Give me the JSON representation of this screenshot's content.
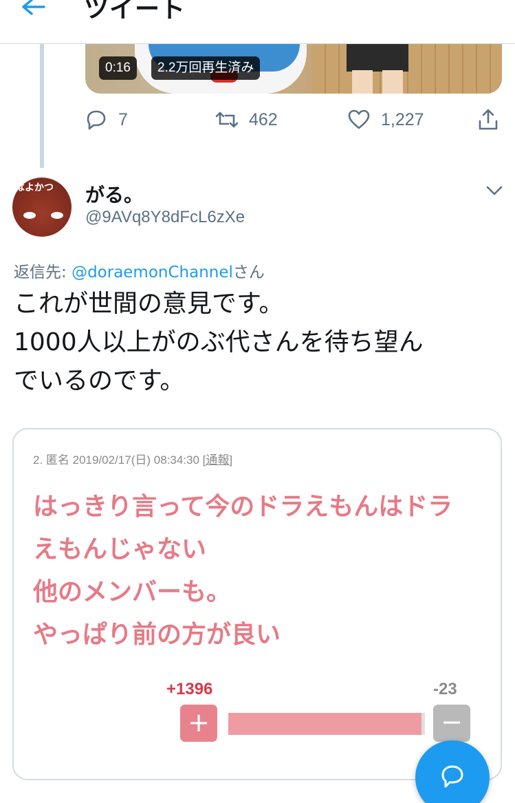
{
  "header": {
    "title": "ツイート"
  },
  "media": {
    "duration": "0:16",
    "views": "2.2万回再生済み"
  },
  "actions": {
    "replies": "7",
    "retweets": "462",
    "likes": "1,227"
  },
  "reply_tweet": {
    "avatar_text": "はよかつ",
    "name": "がる。",
    "handle": "@9AVq8Y8dFcL6zXe",
    "reply_to_prefix": "返信先: ",
    "reply_to_mention": "@doraemonChannel",
    "reply_to_suffix": "さん",
    "text_lines": [
      "これが世間の意見です。",
      "1000人以上がのぶ代さんを待ち望ん",
      "でいるのです。"
    ]
  },
  "quoted_card": {
    "meta_prefix": "2. 匿名 2019/02/17(日) 08:34:30 ",
    "meta_report": "[通報]",
    "comment_lines": [
      "はっきり言って今のドラえもんはドラ",
      "えもんじゃない",
      "他のメンバーも。",
      "やっぱり前の方が良い"
    ],
    "plus_count": "+1396",
    "minus_count": "-23",
    "plus_symbol": "+",
    "minus_symbol": "−",
    "approval_fraction": 0.984
  },
  "colors": {
    "accent": "#1d9bf0",
    "quote_text": "#e67a86",
    "plus": "#d33b48"
  }
}
